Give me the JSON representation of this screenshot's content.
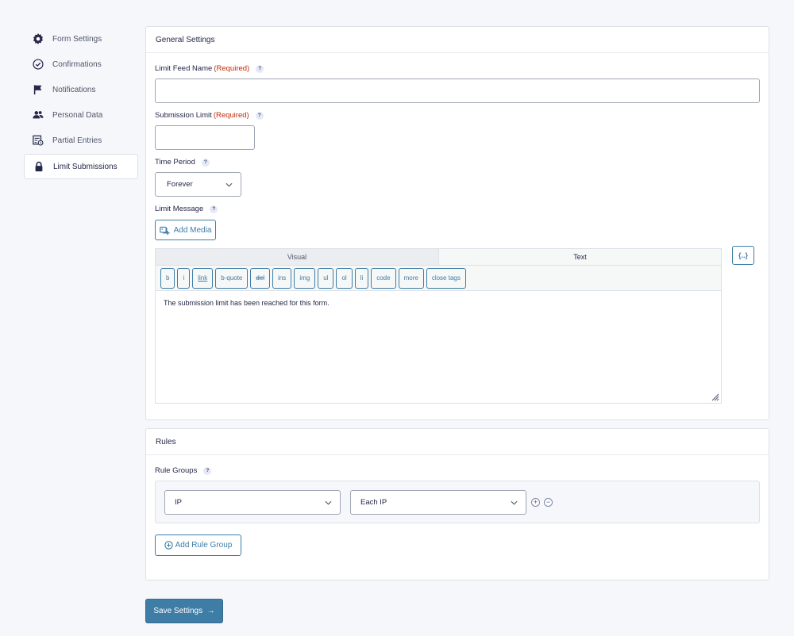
{
  "sidebar": {
    "items": [
      {
        "label": "Form Settings",
        "icon": "gear-icon"
      },
      {
        "label": "Confirmations",
        "icon": "check-circle-icon"
      },
      {
        "label": "Notifications",
        "icon": "flag-icon"
      },
      {
        "label": "Personal Data",
        "icon": "users-icon"
      },
      {
        "label": "Partial Entries",
        "icon": "partial-entries-icon"
      },
      {
        "label": "Limit Submissions",
        "icon": "lock-icon",
        "active": true
      }
    ]
  },
  "general": {
    "title": "General Settings",
    "feed_name_label": "Limit Feed Name",
    "feed_name_required": "(Required)",
    "feed_name_value": "",
    "limit_label": "Submission Limit",
    "limit_required": "(Required)",
    "limit_value": "",
    "period_label": "Time Period",
    "period_value": "Forever",
    "message_label": "Limit Message",
    "add_media": "Add Media",
    "editor": {
      "tab_visual": "Visual",
      "tab_text": "Text",
      "quicktags": [
        "b",
        "i",
        "link",
        "b-quote",
        "del",
        "ins",
        "img",
        "ul",
        "ol",
        "li",
        "code",
        "more",
        "close tags"
      ],
      "content": "The submission limit has been reached for this form."
    },
    "merge_tag_button": "{..}"
  },
  "rules": {
    "title": "Rules",
    "groups_label": "Rule Groups",
    "rule_type": "IP",
    "rule_value": "Each IP",
    "add_label": "+",
    "remove_label": "−",
    "add_group": "Add Rule Group"
  },
  "help_glyph": "?",
  "save_button": "Save Settings  →",
  "colors": {
    "accent": "#3e7da6",
    "required": "#c02b0a",
    "background": "#f5f7fa"
  }
}
